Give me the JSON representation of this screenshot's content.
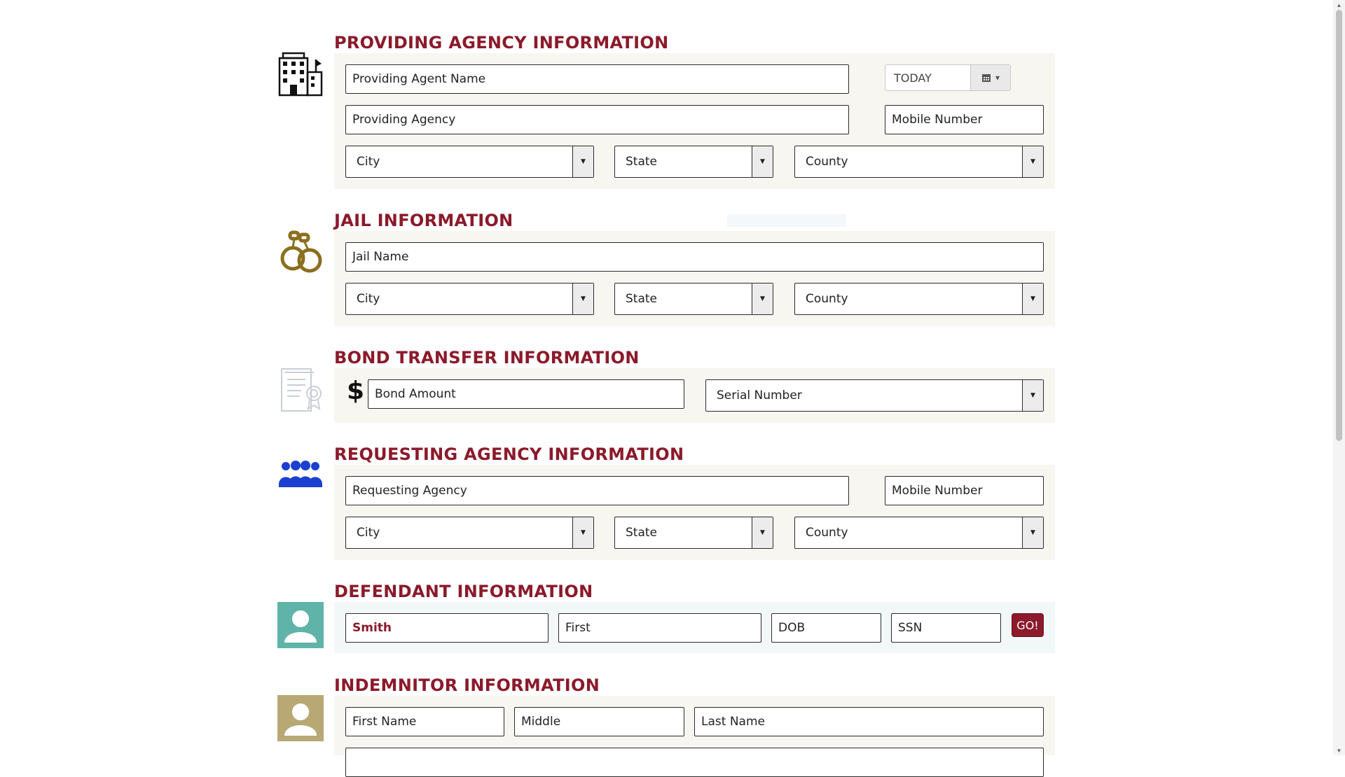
{
  "providing": {
    "title": "PROVIDING AGENCY INFORMATION",
    "agent_name": "Providing Agent Name",
    "date": "TODAY",
    "agency": "Providing Agency",
    "mobile": "Mobile Number",
    "city": "City",
    "state": "State",
    "county": "County"
  },
  "jail": {
    "title": "JAIL INFORMATION",
    "name": "Jail Name",
    "city": "City",
    "state": "State",
    "county": "County"
  },
  "bond": {
    "title": "BOND TRANSFER INFORMATION",
    "currency": "$",
    "amount": "Bond Amount",
    "serial": "Serial Number"
  },
  "requesting": {
    "title": "REQUESTING AGENCY INFORMATION",
    "agency": "Requesting Agency",
    "mobile": "Mobile Number",
    "city": "City",
    "state": "State",
    "county": "County"
  },
  "defendant": {
    "title": "DEFENDANT INFORMATION",
    "last": "Smith",
    "first": "First",
    "dob": "DOB",
    "ssn": "SSN",
    "go": "GO!"
  },
  "indemnitor": {
    "title": "INDEMNITOR INFORMATION",
    "first": "First Name",
    "middle": "Middle",
    "last": "Last Name"
  },
  "colors": {
    "accent": "#8b1a2b",
    "jail_icon": "#8b6f1e",
    "requesting_icon": "#1a3fd1",
    "defendant_icon": "#5fb3a8",
    "indemnitor_icon": "#b8a873"
  },
  "icons": {
    "providing": "building-icon",
    "jail": "handcuffs-icon",
    "bond": "certificate-icon",
    "requesting": "group-icon",
    "defendant": "person-icon",
    "indemnitor": "person-icon"
  }
}
